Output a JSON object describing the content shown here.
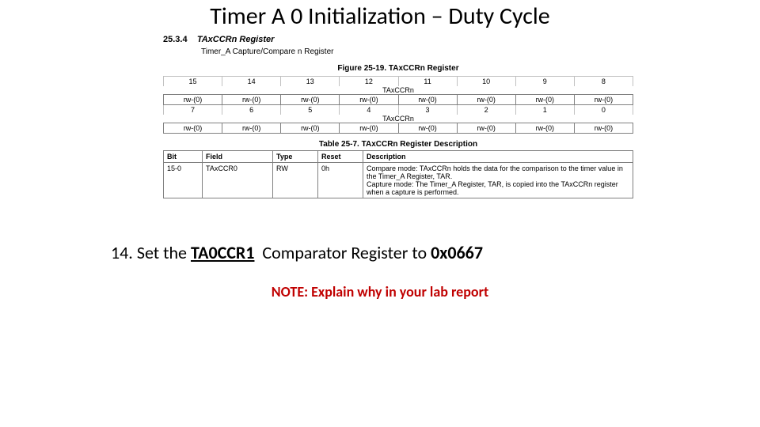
{
  "title": "Timer A 0 Initialization – Duty Cycle",
  "datasheet": {
    "section_number": "25.3.4",
    "section_title": "TAxCCRn Register",
    "section_subtitle": "Timer_A Capture/Compare n Register",
    "figure_caption": "Figure 25-19. TAxCCRn Register",
    "bits_high": [
      "15",
      "14",
      "13",
      "12",
      "11",
      "10",
      "9",
      "8"
    ],
    "field_name": "TAxCCRn",
    "rw_value": "rw-(0)",
    "bits_low": [
      "7",
      "6",
      "5",
      "4",
      "3",
      "2",
      "1",
      "0"
    ],
    "table_caption": "Table 25-7. TAxCCRn Register Description",
    "columns": {
      "bit": "Bit",
      "field": "Field",
      "type": "Type",
      "reset": "Reset",
      "desc": "Description"
    },
    "row": {
      "bit": "15-0",
      "field": "TAxCCR0",
      "type": "RW",
      "reset": "0h",
      "desc_line1": "Compare mode: TAxCCRn holds the data for the comparison to the timer value in the Timer_A Register, TAR.",
      "desc_line2": "Capture mode: The Timer_A Register, TAR, is copied into the TAxCCRn register when a capture is performed."
    }
  },
  "instruction": {
    "step_no": "14.",
    "prefix": "Set the",
    "register": "TA0CCR1",
    "middle": "Comparator Register to",
    "value": "0x0667"
  },
  "note": "NOTE: Explain why in your lab report"
}
